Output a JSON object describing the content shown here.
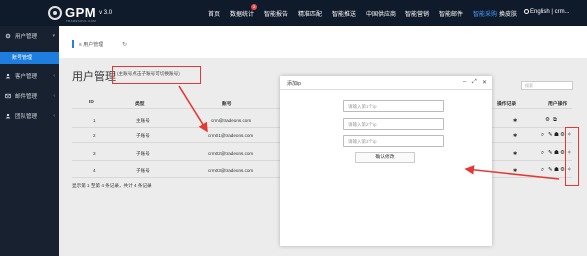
{
  "header": {
    "logo_text": "GPM",
    "logo_subtitle": "TRADESOUL.COM",
    "version": "v 3.0",
    "nav": [
      {
        "label": "首页",
        "active": false
      },
      {
        "label": "数据统计",
        "active": false,
        "badge": "3"
      },
      {
        "label": "智能报告",
        "active": false
      },
      {
        "label": "精准匹配",
        "active": false
      },
      {
        "label": "智能推送",
        "active": false
      },
      {
        "label": "中国供应商",
        "active": false
      },
      {
        "label": "智能营销",
        "active": false
      },
      {
        "label": "智能邮件",
        "active": false
      },
      {
        "label": "智能采购",
        "active": true
      }
    ],
    "switch_label": "换皮肤",
    "lang_label": "English",
    "user_label": "crm..."
  },
  "sidebar": {
    "items": [
      {
        "label": "用户管理",
        "icon": "gear-icon"
      },
      {
        "label": "客户管理",
        "icon": "user-icon"
      },
      {
        "label": "邮件管理",
        "icon": "mail-icon"
      },
      {
        "label": "团队管理",
        "icon": "team-icon"
      }
    ],
    "active_sub": "账号管理"
  },
  "breadcrumb": {
    "label": "≡ 用户管理",
    "refresh_icon": "refresh-icon"
  },
  "page": {
    "title": "用户管理",
    "hint": "(主账号点击子账号可切换账号)",
    "search_placeholder": "搜索"
  },
  "table": {
    "headers": [
      "ID",
      "类型",
      "账号",
      "操作记录",
      "用户操作"
    ],
    "rows": [
      {
        "id": "1",
        "type": "主账号",
        "account": "crm@tradeons.com"
      },
      {
        "id": "2",
        "type": "子账号",
        "account": "crm01@tradeons.com"
      },
      {
        "id": "3",
        "type": "子账号",
        "account": "crm02@tradeons.com"
      },
      {
        "id": "4",
        "type": "子账号",
        "account": "crm03@tradeons.com"
      }
    ],
    "footer": "显示第 1 至第 4 条记录，共计 4 条记录"
  },
  "modal": {
    "title": "添加ip",
    "ip_placeholders": [
      "请输入第1个ip",
      "请输入第2个ip",
      "请输入第3个ip"
    ],
    "confirm_label": "确认修改"
  },
  "colors": {
    "topbar": "#0f1a2b",
    "accent": "#1e7ee0",
    "annotation": "#e53935"
  }
}
